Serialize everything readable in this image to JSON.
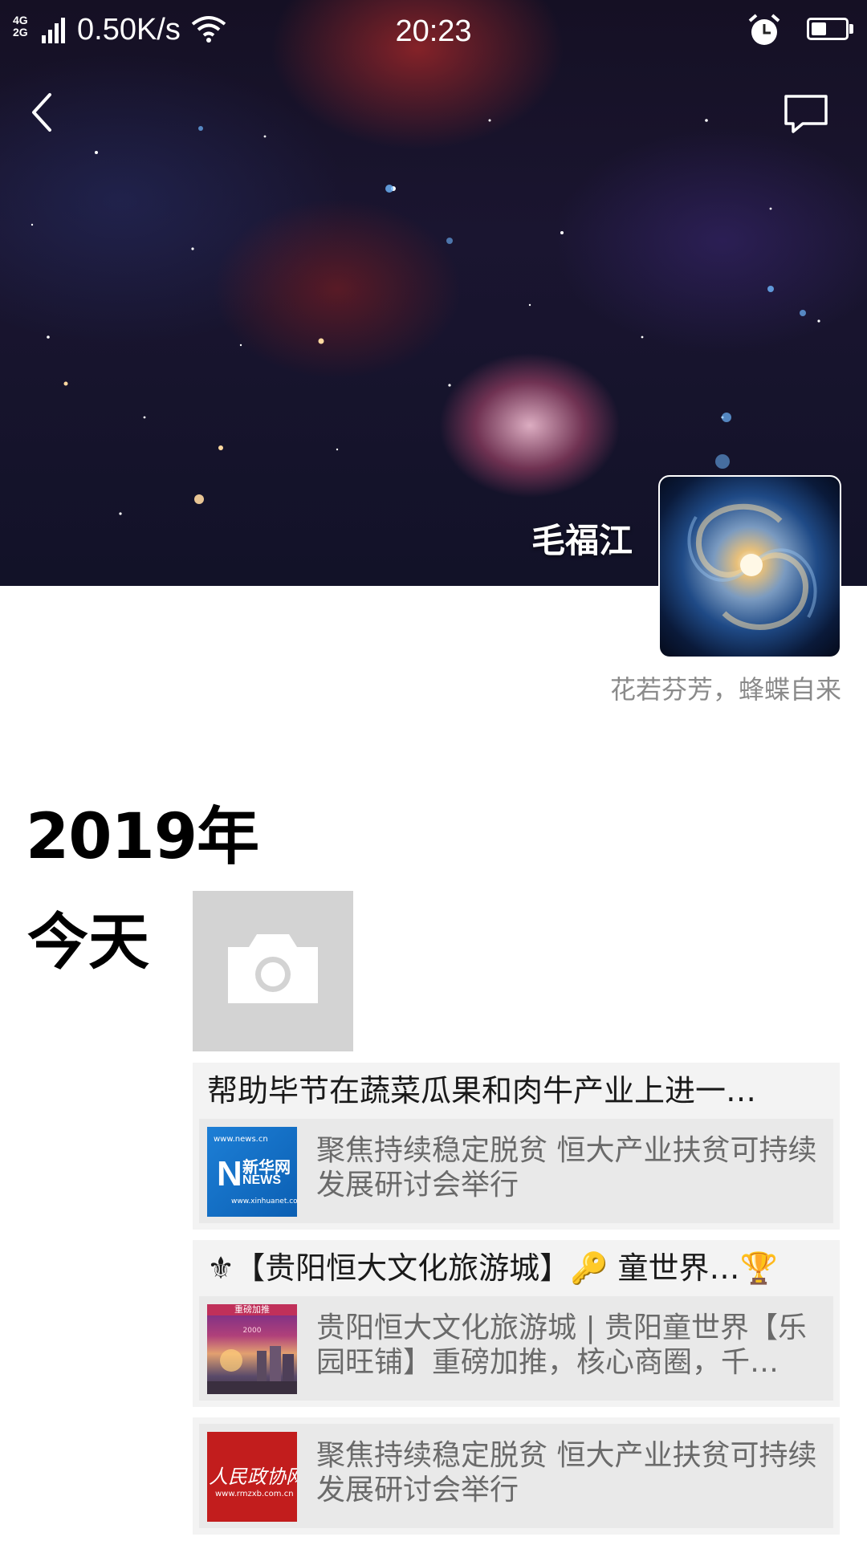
{
  "status_bar": {
    "network": "4G\n2G",
    "speed": "0.50K/s",
    "time": "20:23",
    "battery_level": 0.45
  },
  "header": {
    "back_icon": "chevron-left-icon",
    "comment_icon": "speech-bubble-icon"
  },
  "profile": {
    "name": "毛福江",
    "signature": "花若芬芳，蜂蝶自来"
  },
  "timeline": {
    "year": "2019年",
    "day": "今天",
    "posts": [
      {
        "title": "帮助毕节在蔬菜瓜果和肉牛产业上进一…",
        "link_text": "聚焦持续稳定脱贫 恒大产业扶贫可持续发展研讨会举行",
        "thumb_text": "新华网",
        "thumb_sub": "NEWS",
        "thumb_url": "www.news.cn",
        "thumb_url2": "www.xinhuanet.com"
      },
      {
        "title": "⚜【贵阳恒大文化旅游城】🔑 童世界…🏆",
        "link_text": "贵阳恒大文化旅游城 | 贵阳童世界【乐园旺铺】重磅加推，核心商圈，千…",
        "thumb_text": "重磅加推",
        "thumb_sub": "2000"
      },
      {
        "link_text": "聚焦持续稳定脱贫 恒大产业扶贫可持续发展研讨会举行",
        "thumb_text": "人民政协网",
        "thumb_url": "www.rmzxb.com.cn"
      }
    ]
  }
}
